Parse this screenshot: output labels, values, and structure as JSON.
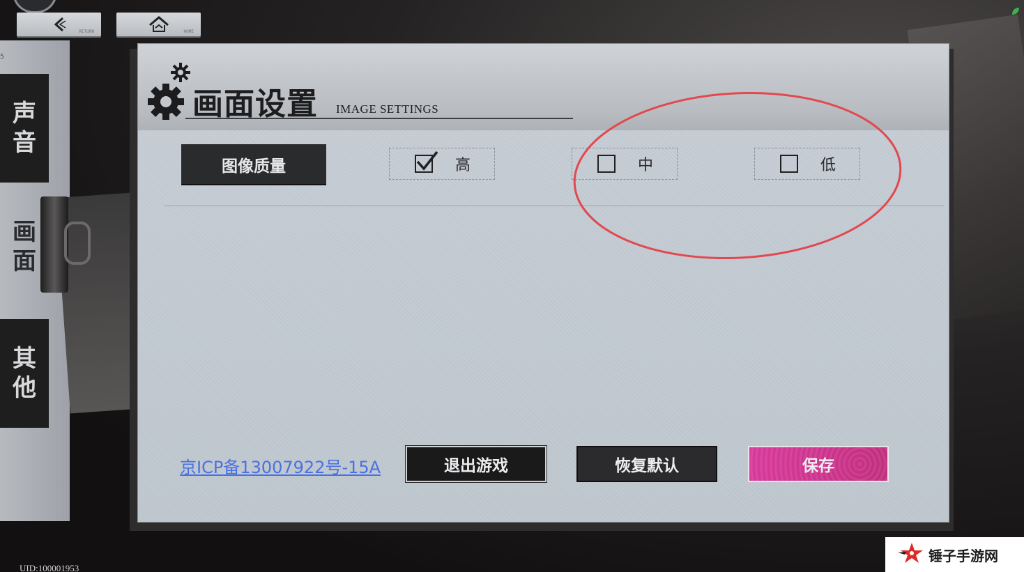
{
  "nav": {
    "back_sub": "RETURN",
    "home_sub": "HOME"
  },
  "side_tabs": [
    {
      "label_1": "声",
      "label_2": "音"
    },
    {
      "label_1": "画",
      "label_2": "面"
    },
    {
      "label_1": "其",
      "label_2": "他"
    }
  ],
  "panel": {
    "title": "画面设置",
    "subtitle": "IMAGE SETTINGS"
  },
  "quality": {
    "label": "图像质量",
    "options": [
      {
        "label": "高",
        "checked": true
      },
      {
        "label": "中",
        "checked": false
      },
      {
        "label": "低",
        "checked": false
      }
    ]
  },
  "footer": {
    "icp": "京ICP备13007922号-15A",
    "quit_label": "退出游戏",
    "reset_label": "恢复默认",
    "save_label": "保存"
  },
  "uid": "UID:100001953",
  "watermark": {
    "text": "锤子手游网"
  },
  "colors": {
    "accent_save": "#d93a9c",
    "link": "#4a71e3",
    "annotation": "#e2484f"
  }
}
